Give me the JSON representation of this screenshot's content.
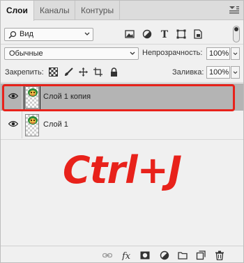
{
  "tabs": [
    {
      "label": "Слои",
      "active": true
    },
    {
      "label": "Каналы",
      "active": false
    },
    {
      "label": "Контуры",
      "active": false
    }
  ],
  "filter": {
    "kind_label": "Вид",
    "icons": [
      "image-filter-icon",
      "adjustment-filter-icon",
      "type-filter-icon",
      "shape-filter-icon",
      "smart-object-filter-icon"
    ]
  },
  "blend": {
    "mode": "Обычные",
    "opacity_label": "Непрозрачность:",
    "opacity_value": "100%"
  },
  "lock": {
    "label": "Закрепить:",
    "fill_label": "Заливка:",
    "fill_value": "100%"
  },
  "layers": [
    {
      "name": "Слой 1 копия",
      "selected": true,
      "visible": true
    },
    {
      "name": "Слой 1",
      "selected": false,
      "visible": true
    }
  ],
  "annotation": {
    "text": "Ctrl+J",
    "color": "#e8221b"
  },
  "bottom_icons": [
    "link-icon",
    "fx-icon",
    "mask-icon",
    "adjustment-layer-icon",
    "group-folder-icon",
    "new-layer-icon",
    "trash-icon"
  ],
  "colors": {
    "selection": "#b4b4b4",
    "highlight": "#e8221b"
  }
}
